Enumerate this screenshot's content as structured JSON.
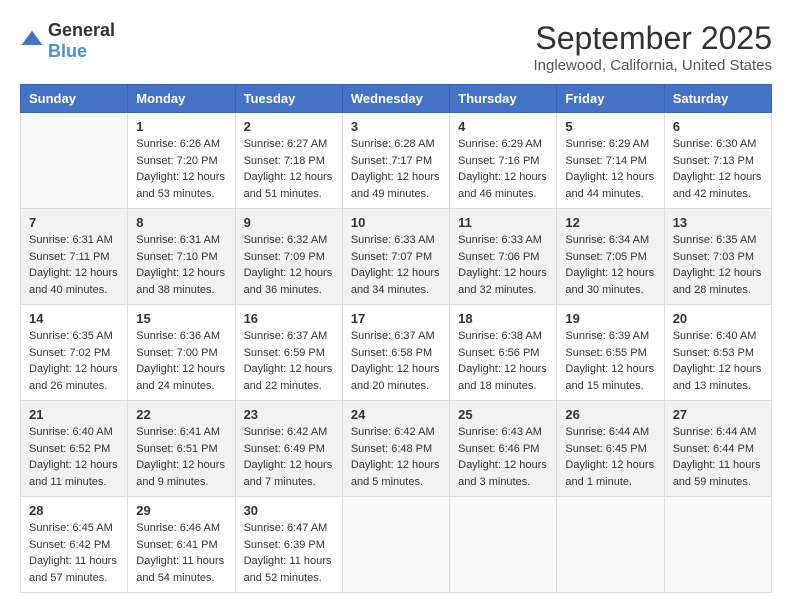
{
  "logo": {
    "general": "General",
    "blue": "Blue"
  },
  "title": "September 2025",
  "subtitle": "Inglewood, California, United States",
  "days_of_week": [
    "Sunday",
    "Monday",
    "Tuesday",
    "Wednesday",
    "Thursday",
    "Friday",
    "Saturday"
  ],
  "weeks": [
    [
      {
        "day": "",
        "content": ""
      },
      {
        "day": "1",
        "content": "Sunrise: 6:26 AM\nSunset: 7:20 PM\nDaylight: 12 hours\nand 53 minutes."
      },
      {
        "day": "2",
        "content": "Sunrise: 6:27 AM\nSunset: 7:18 PM\nDaylight: 12 hours\nand 51 minutes."
      },
      {
        "day": "3",
        "content": "Sunrise: 6:28 AM\nSunset: 7:17 PM\nDaylight: 12 hours\nand 49 minutes."
      },
      {
        "day": "4",
        "content": "Sunrise: 6:29 AM\nSunset: 7:16 PM\nDaylight: 12 hours\nand 46 minutes."
      },
      {
        "day": "5",
        "content": "Sunrise: 6:29 AM\nSunset: 7:14 PM\nDaylight: 12 hours\nand 44 minutes."
      },
      {
        "day": "6",
        "content": "Sunrise: 6:30 AM\nSunset: 7:13 PM\nDaylight: 12 hours\nand 42 minutes."
      }
    ],
    [
      {
        "day": "7",
        "content": "Sunrise: 6:31 AM\nSunset: 7:11 PM\nDaylight: 12 hours\nand 40 minutes."
      },
      {
        "day": "8",
        "content": "Sunrise: 6:31 AM\nSunset: 7:10 PM\nDaylight: 12 hours\nand 38 minutes."
      },
      {
        "day": "9",
        "content": "Sunrise: 6:32 AM\nSunset: 7:09 PM\nDaylight: 12 hours\nand 36 minutes."
      },
      {
        "day": "10",
        "content": "Sunrise: 6:33 AM\nSunset: 7:07 PM\nDaylight: 12 hours\nand 34 minutes."
      },
      {
        "day": "11",
        "content": "Sunrise: 6:33 AM\nSunset: 7:06 PM\nDaylight: 12 hours\nand 32 minutes."
      },
      {
        "day": "12",
        "content": "Sunrise: 6:34 AM\nSunset: 7:05 PM\nDaylight: 12 hours\nand 30 minutes."
      },
      {
        "day": "13",
        "content": "Sunrise: 6:35 AM\nSunset: 7:03 PM\nDaylight: 12 hours\nand 28 minutes."
      }
    ],
    [
      {
        "day": "14",
        "content": "Sunrise: 6:35 AM\nSunset: 7:02 PM\nDaylight: 12 hours\nand 26 minutes."
      },
      {
        "day": "15",
        "content": "Sunrise: 6:36 AM\nSunset: 7:00 PM\nDaylight: 12 hours\nand 24 minutes."
      },
      {
        "day": "16",
        "content": "Sunrise: 6:37 AM\nSunset: 6:59 PM\nDaylight: 12 hours\nand 22 minutes."
      },
      {
        "day": "17",
        "content": "Sunrise: 6:37 AM\nSunset: 6:58 PM\nDaylight: 12 hours\nand 20 minutes."
      },
      {
        "day": "18",
        "content": "Sunrise: 6:38 AM\nSunset: 6:56 PM\nDaylight: 12 hours\nand 18 minutes."
      },
      {
        "day": "19",
        "content": "Sunrise: 6:39 AM\nSunset: 6:55 PM\nDaylight: 12 hours\nand 15 minutes."
      },
      {
        "day": "20",
        "content": "Sunrise: 6:40 AM\nSunset: 6:53 PM\nDaylight: 12 hours\nand 13 minutes."
      }
    ],
    [
      {
        "day": "21",
        "content": "Sunrise: 6:40 AM\nSunset: 6:52 PM\nDaylight: 12 hours\nand 11 minutes."
      },
      {
        "day": "22",
        "content": "Sunrise: 6:41 AM\nSunset: 6:51 PM\nDaylight: 12 hours\nand 9 minutes."
      },
      {
        "day": "23",
        "content": "Sunrise: 6:42 AM\nSunset: 6:49 PM\nDaylight: 12 hours\nand 7 minutes."
      },
      {
        "day": "24",
        "content": "Sunrise: 6:42 AM\nSunset: 6:48 PM\nDaylight: 12 hours\nand 5 minutes."
      },
      {
        "day": "25",
        "content": "Sunrise: 6:43 AM\nSunset: 6:46 PM\nDaylight: 12 hours\nand 3 minutes."
      },
      {
        "day": "26",
        "content": "Sunrise: 6:44 AM\nSunset: 6:45 PM\nDaylight: 12 hours\nand 1 minute."
      },
      {
        "day": "27",
        "content": "Sunrise: 6:44 AM\nSunset: 6:44 PM\nDaylight: 11 hours\nand 59 minutes."
      }
    ],
    [
      {
        "day": "28",
        "content": "Sunrise: 6:45 AM\nSunset: 6:42 PM\nDaylight: 11 hours\nand 57 minutes."
      },
      {
        "day": "29",
        "content": "Sunrise: 6:46 AM\nSunset: 6:41 PM\nDaylight: 11 hours\nand 54 minutes."
      },
      {
        "day": "30",
        "content": "Sunrise: 6:47 AM\nSunset: 6:39 PM\nDaylight: 11 hours\nand 52 minutes."
      },
      {
        "day": "",
        "content": ""
      },
      {
        "day": "",
        "content": ""
      },
      {
        "day": "",
        "content": ""
      },
      {
        "day": "",
        "content": ""
      }
    ]
  ],
  "colors": {
    "header_bg": "#4472c4",
    "header_text": "#ffffff",
    "odd_row_bg": "#ffffff",
    "even_row_bg": "#f2f2f2"
  }
}
